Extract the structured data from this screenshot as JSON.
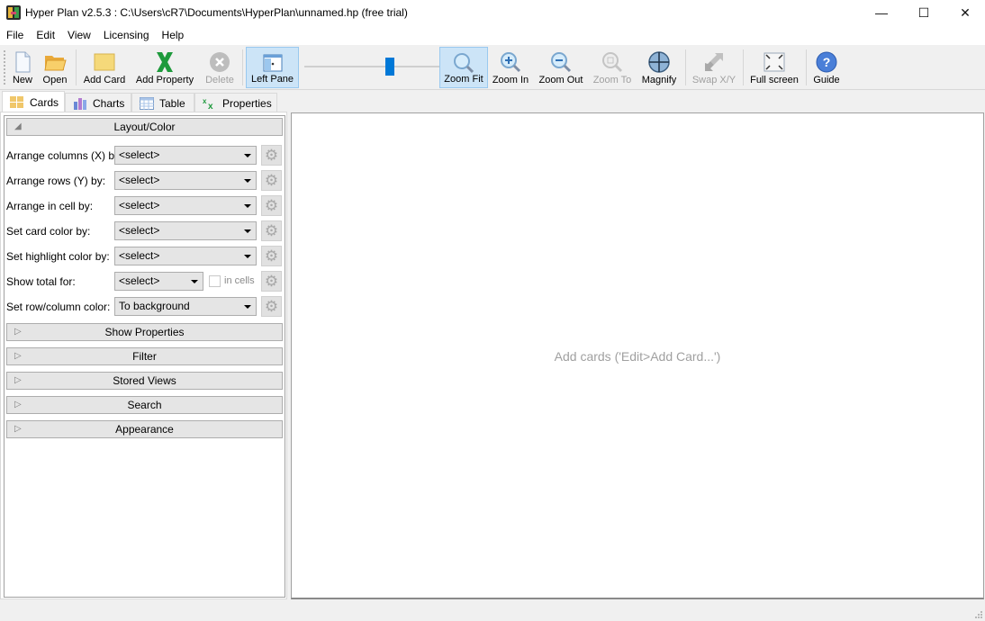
{
  "window": {
    "title": "Hyper Plan v2.5.3 : C:\\Users\\cR7\\Documents\\HyperPlan\\unnamed.hp (free trial)",
    "controls": {
      "minimize": "—",
      "maximize": "☐",
      "close": "✕"
    }
  },
  "menu": [
    "File",
    "Edit",
    "View",
    "Licensing",
    "Help"
  ],
  "toolbar": {
    "new": "New",
    "open": "Open",
    "add_card": "Add Card",
    "add_property": "Add Property",
    "delete": "Delete",
    "left_pane": "Left Pane",
    "zoom_slider_value_fraction": 0.63,
    "zoom_fit": "Zoom Fit",
    "zoom_in": "Zoom In",
    "zoom_out": "Zoom Out",
    "zoom_to": "Zoom To",
    "magnify": "Magnify",
    "swap_xy": "Swap X/Y",
    "full_screen": "Full screen",
    "guide": "Guide"
  },
  "tabs": [
    {
      "label": "Cards",
      "icon": "cards-icon",
      "selected": true
    },
    {
      "label": "Charts",
      "icon": "charts-icon",
      "selected": false
    },
    {
      "label": "Table",
      "icon": "table-icon",
      "selected": false
    },
    {
      "label": "Properties",
      "icon": "properties-icon",
      "selected": false
    }
  ],
  "left_pane": {
    "layout_section": {
      "title": "Layout/Color",
      "expanded": true,
      "rows": [
        {
          "label": "Arrange columns (X) by:",
          "value": "<select>"
        },
        {
          "label": "Arrange rows (Y) by:",
          "value": "<select>"
        },
        {
          "label": "Arrange in cell by:",
          "value": "<select>"
        },
        {
          "label": "Set card color by:",
          "value": "<select>"
        },
        {
          "label": "Set highlight color by:",
          "value": "<select>"
        },
        {
          "label": "Show total for:",
          "value": "<select>",
          "checkbox_label": "in cells",
          "checked": false
        },
        {
          "label": "Set row/column color:",
          "value": "To background"
        }
      ]
    },
    "collapsed_sections": [
      "Show Properties",
      "Filter",
      "Stored Views",
      "Search",
      "Appearance"
    ]
  },
  "main": {
    "placeholder": "Add cards ('Edit>Add Card...')"
  },
  "colors": {
    "accent": "#0078d7",
    "active_button_bg": "#cce4f7",
    "placeholder_text": "#a0a0a0"
  }
}
